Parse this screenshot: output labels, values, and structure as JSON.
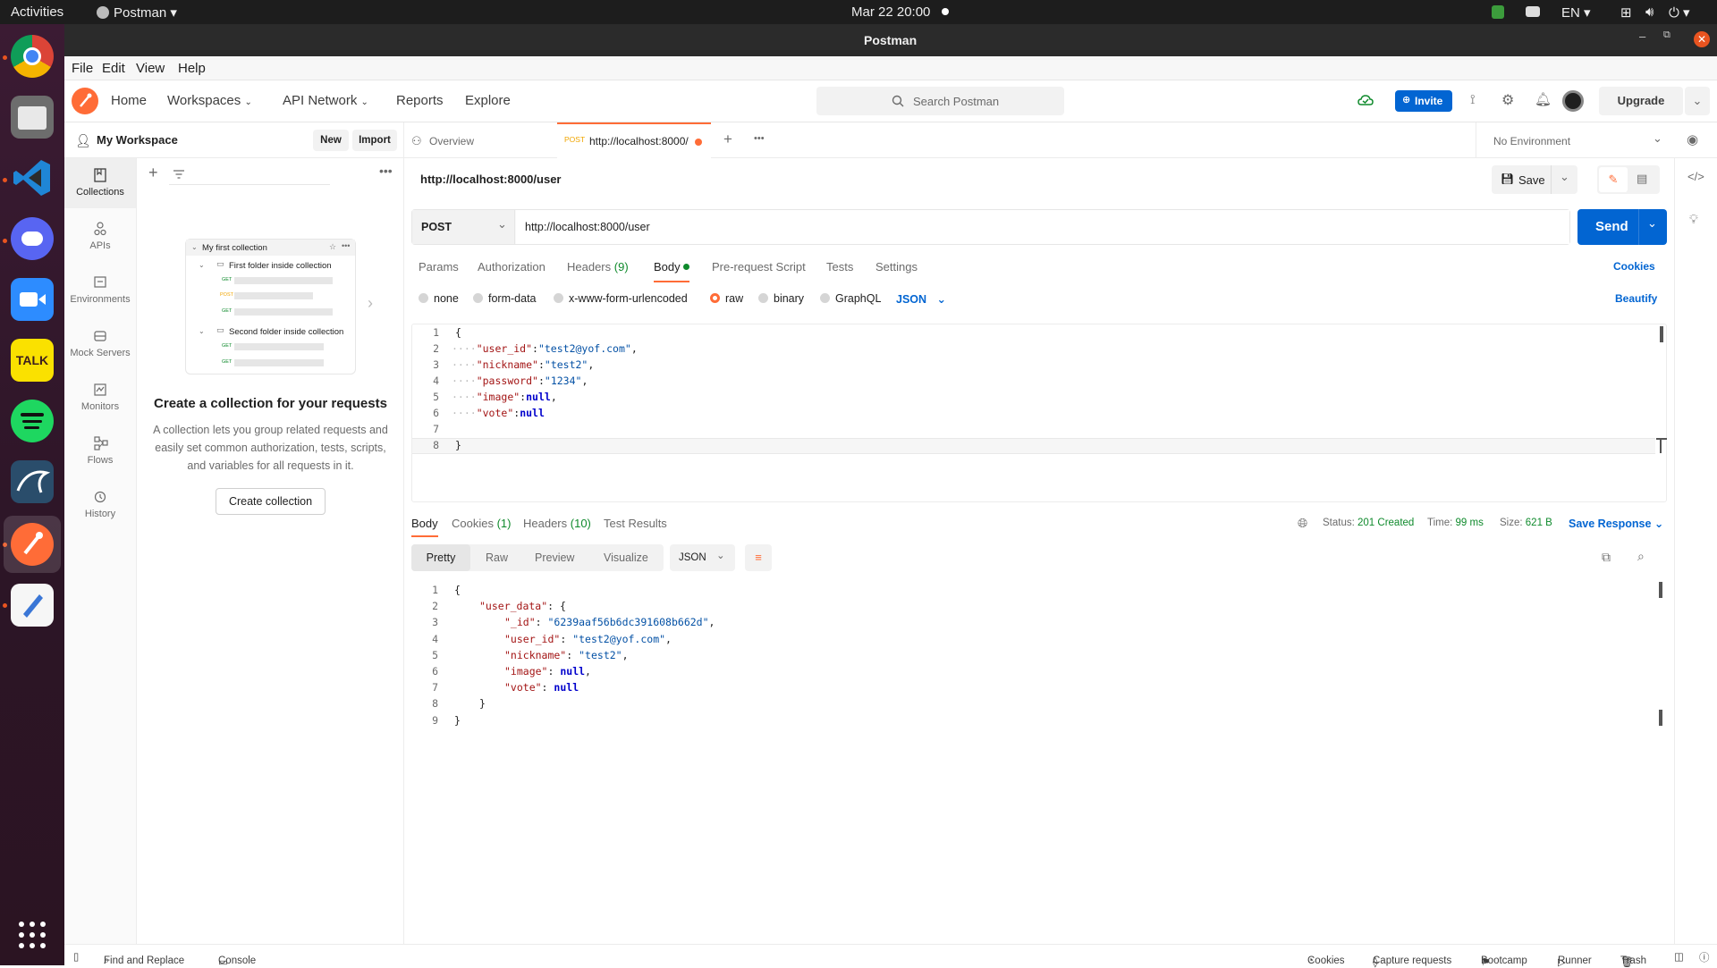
{
  "system": {
    "activities": "Activities",
    "app_menu": "Postman",
    "clock": "Mar 22  20:00",
    "lang": "EN"
  },
  "window": {
    "title": "Postman"
  },
  "menubar": [
    "File",
    "Edit",
    "View",
    "Help"
  ],
  "header": {
    "nav": [
      "Home",
      "Workspaces",
      "API Network",
      "Reports",
      "Explore"
    ],
    "search_placeholder": "Search Postman",
    "invite": "Invite",
    "upgrade": "Upgrade"
  },
  "workspace": {
    "name": "My Workspace",
    "new": "New",
    "import": "Import"
  },
  "leftnav": [
    "Collections",
    "APIs",
    "Environments",
    "Mock Servers",
    "Monitors",
    "Flows",
    "History"
  ],
  "collection_pane": {
    "illus_title": "My first collection",
    "folder1": "First folder inside collection",
    "folder2": "Second folder inside collection",
    "methods": [
      "GET",
      "POST",
      "GET",
      "GET",
      "GET"
    ],
    "heading": "Create a collection for your requests",
    "desc": "A collection lets you group related requests and easily set common authorization, tests, scripts, and variables for all requests in it.",
    "button": "Create collection"
  },
  "tabs": {
    "overview": "Overview",
    "active_method": "POST",
    "active_url": "http://localhost:8000/",
    "environment": "No Environment"
  },
  "request": {
    "name": "http://localhost:8000/user",
    "save": "Save",
    "method": "POST",
    "url": "http://localhost:8000/user",
    "send": "Send",
    "subtabs": [
      "Params",
      "Authorization",
      "Headers",
      "Body",
      "Pre-request Script",
      "Tests",
      "Settings"
    ],
    "headers_count": "(9)",
    "cookies": "Cookies",
    "body_types": [
      "none",
      "form-data",
      "x-www-form-urlencoded",
      "raw",
      "binary",
      "GraphQL"
    ],
    "body_format": "JSON",
    "beautify": "Beautify",
    "body_lines": [
      {
        "n": "1",
        "k": "",
        "v": "{"
      },
      {
        "n": "2",
        "k": "\"user_id\"",
        "v": "\"test2@yof.com\""
      },
      {
        "n": "3",
        "k": "\"nickname\"",
        "v": "\"test2\""
      },
      {
        "n": "4",
        "k": "\"password\"",
        "v": "\"1234\""
      },
      {
        "n": "5",
        "k": "\"image\"",
        "v": "null"
      },
      {
        "n": "6",
        "k": "\"vote\"",
        "v": "null"
      },
      {
        "n": "7",
        "k": "",
        "v": ""
      },
      {
        "n": "8",
        "k": "",
        "v": "}"
      }
    ]
  },
  "response": {
    "tabs": [
      "Body",
      "Cookies",
      "Headers",
      "Test Results"
    ],
    "cookies_count": "(1)",
    "headers_count": "(10)",
    "status_label": "Status:",
    "status": "201 Created",
    "time_label": "Time:",
    "time": "99 ms",
    "size_label": "Size:",
    "size": "621 B",
    "save_response": "Save Response",
    "views": [
      "Pretty",
      "Raw",
      "Preview",
      "Visualize"
    ],
    "format": "JSON",
    "lines": [
      {
        "n": "1",
        "t": "{"
      },
      {
        "n": "2",
        "t": "\"user_data\": {"
      },
      {
        "n": "3",
        "t": "\"_id\": \"6239aaf56b6dc391608b662d\","
      },
      {
        "n": "4",
        "t": "\"user_id\": \"test2@yof.com\","
      },
      {
        "n": "5",
        "t": "\"nickname\": \"test2\","
      },
      {
        "n": "6",
        "t": "\"image\": null,"
      },
      {
        "n": "7",
        "t": "\"vote\": null"
      },
      {
        "n": "8",
        "t": "}"
      },
      {
        "n": "9",
        "t": "}"
      }
    ]
  },
  "statusbar": {
    "find": "Find and Replace",
    "console": "Console",
    "cookies": "Cookies",
    "capture": "Capture requests",
    "bootcamp": "Bootcamp",
    "runner": "Runner",
    "trash": "Trash"
  },
  "colors": {
    "accent": "#ff6c37",
    "send": "#0265d2",
    "status_ok": "#0f8a2c"
  }
}
